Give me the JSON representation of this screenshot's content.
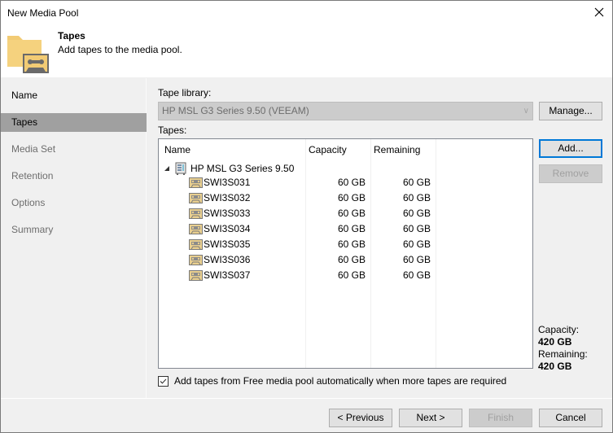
{
  "window": {
    "title": "New Media Pool",
    "close_label": "Close"
  },
  "header": {
    "title": "Tapes",
    "subtitle": "Add tapes to the media pool.",
    "icon": "folder-tape-icon"
  },
  "sidebar": {
    "items": [
      {
        "label": "Name",
        "state": "done"
      },
      {
        "label": "Tapes",
        "state": "active"
      },
      {
        "label": "Media Set",
        "state": "pending"
      },
      {
        "label": "Retention",
        "state": "pending"
      },
      {
        "label": "Options",
        "state": "pending"
      },
      {
        "label": "Summary",
        "state": "pending"
      }
    ]
  },
  "content": {
    "tape_library_label": "Tape library:",
    "tape_library_value": "HP MSL G3 Series 9.50 (VEEAM)",
    "manage_button": "Manage...",
    "tapes_label": "Tapes:",
    "add_button": "Add...",
    "remove_button": "Remove",
    "columns": [
      "Name",
      "Capacity",
      "Remaining"
    ],
    "library_node": "HP MSL G3 Series 9.50",
    "tapes": [
      {
        "name": "SWI3S031",
        "capacity": "60 GB",
        "remaining": "60 GB"
      },
      {
        "name": "SWI3S032",
        "capacity": "60 GB",
        "remaining": "60 GB"
      },
      {
        "name": "SWI3S033",
        "capacity": "60 GB",
        "remaining": "60 GB"
      },
      {
        "name": "SWI3S034",
        "capacity": "60 GB",
        "remaining": "60 GB"
      },
      {
        "name": "SWI3S035",
        "capacity": "60 GB",
        "remaining": "60 GB"
      },
      {
        "name": "SWI3S036",
        "capacity": "60 GB",
        "remaining": "60 GB"
      },
      {
        "name": "SWI3S037",
        "capacity": "60 GB",
        "remaining": "60 GB"
      }
    ],
    "summary": {
      "capacity_label": "Capacity:",
      "capacity_value": "420 GB",
      "remaining_label": "Remaining:",
      "remaining_value": "420 GB"
    },
    "auto_add_checkbox": {
      "label": "Add tapes from Free media pool automatically when more tapes are required",
      "checked": true
    }
  },
  "footer": {
    "previous": "< Previous",
    "next": "Next >",
    "finish": "Finish",
    "cancel": "Cancel"
  },
  "colors": {
    "accent": "#0078d7",
    "active_step": "#a0a0a0",
    "folder": "#f2cb74"
  }
}
